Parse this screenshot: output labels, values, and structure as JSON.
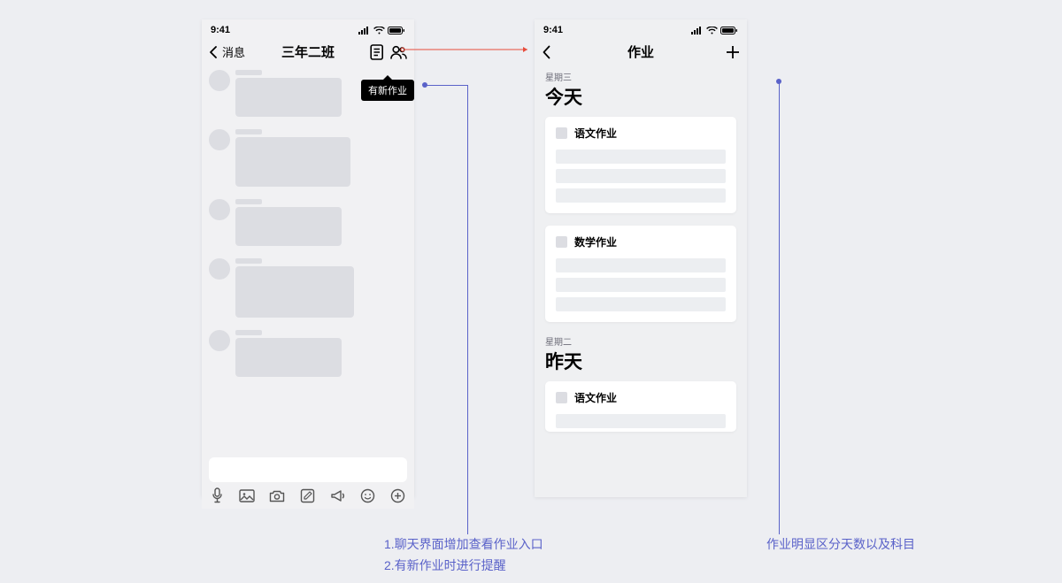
{
  "status": {
    "time": "9:41"
  },
  "leftScreen": {
    "backLabel": "消息",
    "title": "三年二班",
    "tooltip": "有新作业"
  },
  "rightScreen": {
    "title": "作业",
    "sections": [
      {
        "weekday": "星期三",
        "dayTitle": "今天",
        "cards": [
          {
            "subject": "语文作业"
          },
          {
            "subject": "数学作业"
          }
        ]
      },
      {
        "weekday": "星期二",
        "dayTitle": "昨天",
        "cards": [
          {
            "subject": "语文作业"
          }
        ]
      }
    ]
  },
  "annotations": {
    "leftLine1": "1.聊天界面增加查看作业入口",
    "leftLine2": "2.有新作业时进行提醒",
    "right": "作业明显区分天数以及科目"
  }
}
